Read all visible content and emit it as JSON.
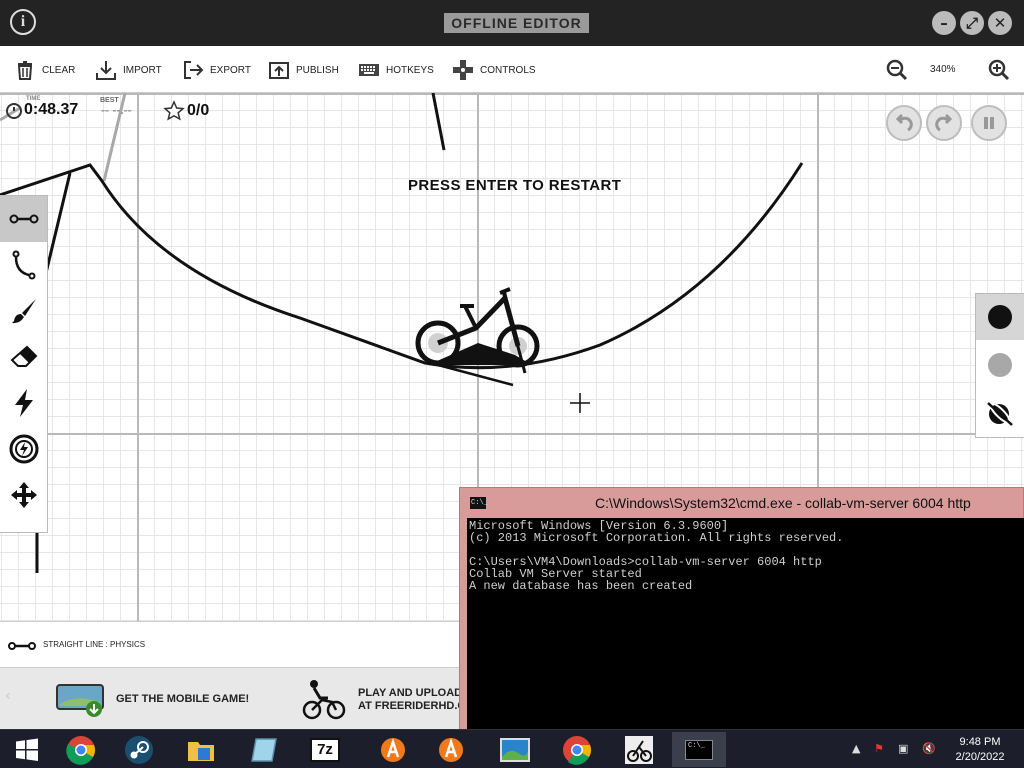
{
  "window": {
    "title": "OFFLINE EDITOR",
    "info_icon": "info-icon",
    "minimize_icon": "minimize-icon",
    "maximize_icon": "fullscreen-icon",
    "close_icon": "close-icon"
  },
  "toolbar": {
    "clear": "CLEAR",
    "import": "IMPORT",
    "export": "EXPORT",
    "publish": "PUBLISH",
    "hotkeys": "HOTKEYS",
    "controls": "CONTROLS",
    "zoom": "340%"
  },
  "hud": {
    "time_label": "TIME",
    "time": "0:48.37",
    "best_label": "BEST",
    "best": "-- --.--",
    "stars": "0/0"
  },
  "game": {
    "message": "PRESS ENTER TO RESTART"
  },
  "tools": [
    "straight-line-tool",
    "curve-tool",
    "brush-tool",
    "eraser-tool",
    "boost-tool",
    "bomb-tool",
    "move-tool"
  ],
  "colors": {
    "physics": "#111111",
    "scenery": "#a8a8a8",
    "grid_major": "#b9b9b9",
    "grid_minor": "#e6e6e6"
  },
  "status": {
    "tool_text": "STRAIGHT LINE : PHYSICS"
  },
  "promo": {
    "mobile": "GET THE MOBILE GAME!",
    "upload_line1": "PLAY AND UPLOAD",
    "upload_line2": "AT FREERIDERHD.CO"
  },
  "cmd": {
    "title": "C:\\Windows\\System32\\cmd.exe - collab-vm-server  6004 http",
    "icon_text": "C:\\_",
    "lines": [
      "Microsoft Windows [Version 6.3.9600]",
      "(c) 2013 Microsoft Corporation. All rights reserved.",
      "",
      "C:\\Users\\VM4\\Downloads>collab-vm-server 6004 http",
      "Collab VM Server started",
      "A new database has been created"
    ]
  },
  "taskbar": {
    "apps": [
      "start-button",
      "chrome-icon",
      "steam-icon",
      "file-explorer-icon",
      "notepad-icon",
      "7zip-icon",
      "avast-icon",
      "avast-icon-2",
      "photos-icon",
      "chrome-canary-icon",
      "freerider-icon",
      "cmd-icon"
    ],
    "seven_zip": "7z",
    "time": "9:48 PM",
    "date": "2/20/2022"
  }
}
